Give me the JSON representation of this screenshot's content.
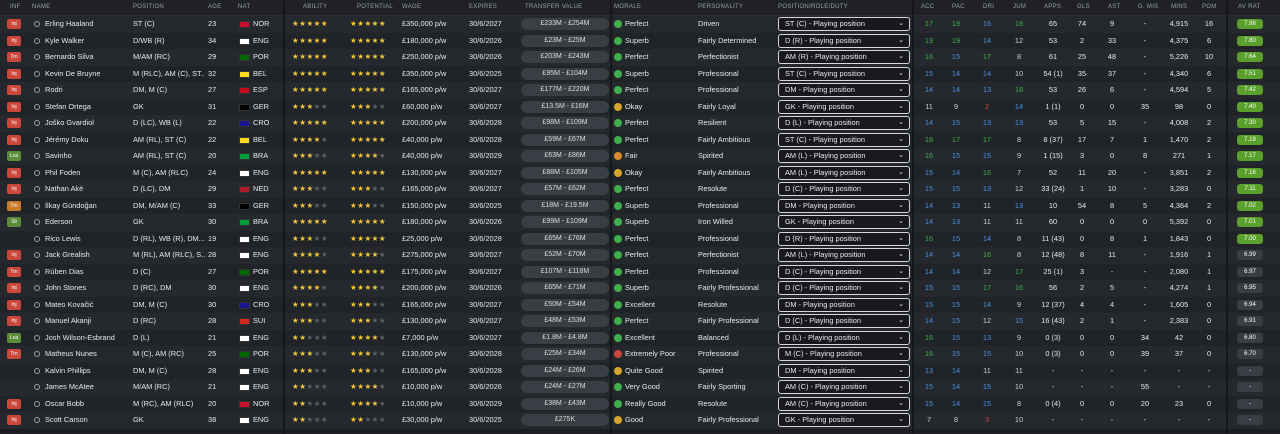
{
  "columns": {
    "inf": "INF",
    "name": "NAME",
    "position": "POSITION",
    "age": "AGE",
    "nat": "NAT",
    "ability": "ABILITY",
    "potential": "POTENTIAL",
    "wage": "WAGE",
    "expires": "EXPIRES",
    "transfer_value": "TRANSFER VALUE",
    "morale": "MORALE",
    "personality": "PERSONALITY",
    "role": "POSITION/ROLE/DUTY",
    "acc": "ACC",
    "pac": "PAC",
    "dri": "DRI",
    "jum": "JUM",
    "apps": "APPS",
    "gls": "GLS",
    "ast": "AST",
    "gmis": "G. MIS",
    "mins": "MINS",
    "pom": "POM",
    "avrat": "AV RAT"
  },
  "players": [
    {
      "inf": "Inj",
      "inf_color": "red",
      "name": "Erling Haaland",
      "position": "ST (C)",
      "age": "23",
      "nat": "NOR",
      "flag": "#c8102e",
      "ability": 5,
      "potential": 5,
      "wage": "£350,000 p/w",
      "expires": "30/6/2027",
      "tv": "£233M - £254M",
      "morale": "Perfect",
      "mico": "g",
      "personality": "Driven",
      "role": "ST (C) - Playing position",
      "acc": "17",
      "pac": "19",
      "dri": "15",
      "jum": "18",
      "apps": "65",
      "gls": "74",
      "ast": "9",
      "gmis": "-",
      "mins": "4,915",
      "pom": "16",
      "avrat": "7.98",
      "hi": true
    },
    {
      "inf": "Inj",
      "inf_color": "red",
      "name": "Kyle Walker",
      "position": "D/WB (R)",
      "age": "34",
      "nat": "ENG",
      "flag": "#ffffff",
      "ability": 4.5,
      "potential": 4.5,
      "wage": "£180,000 p/w",
      "expires": "30/6/2026",
      "tv": "£23M - £25M",
      "morale": "Superb",
      "mico": "g",
      "personality": "Fairly Determined",
      "role": "D (R) - Playing position",
      "acc": "19",
      "pac": "19",
      "dri": "14",
      "jum": "12",
      "apps": "53",
      "gls": "2",
      "ast": "33",
      "gmis": "-",
      "mins": "4,375",
      "pom": "6",
      "avrat": "7.80",
      "hi": true
    },
    {
      "inf": "Trn",
      "inf_color": "red",
      "name": "Bernardo Silva",
      "position": "M/AM (RC)",
      "age": "29",
      "nat": "POR",
      "flag": "#006600",
      "ability": 5,
      "potential": 5,
      "wage": "£250,000 p/w",
      "expires": "30/6/2026",
      "tv": "£203M - £243M",
      "morale": "Perfect",
      "mico": "g",
      "personality": "Perfectionist",
      "role": "AM (R) - Playing position",
      "acc": "16",
      "pac": "15",
      "dri": "17",
      "jum": "8",
      "apps": "61",
      "gls": "25",
      "ast": "48",
      "gmis": "-",
      "mins": "5,226",
      "pom": "10",
      "avrat": "7.64",
      "hi": true
    },
    {
      "inf": "Inj",
      "inf_color": "red",
      "name": "Kevin De Bruyne",
      "position": "M (RLC), AM (C), ST...",
      "age": "32",
      "nat": "BEL",
      "flag": "#fdda24",
      "ability": 5,
      "potential": 5,
      "wage": "£350,000 p/w",
      "expires": "30/6/2025",
      "tv": "£95M - £104M",
      "morale": "Superb",
      "mico": "g",
      "personality": "Professional",
      "role": "ST (C) - Playing position",
      "acc": "15",
      "pac": "14",
      "dri": "14",
      "jum": "10",
      "apps": "54 (1)",
      "gls": "35",
      "ast": "37",
      "gmis": "-",
      "mins": "4,340",
      "pom": "6",
      "avrat": "7.51",
      "hi": true
    },
    {
      "inf": "Inj",
      "inf_color": "red",
      "name": "Rodri",
      "position": "DM, M (C)",
      "age": "27",
      "nat": "ESP",
      "flag": "#c60b1e",
      "ability": 5,
      "potential": 5,
      "wage": "£165,000 p/w",
      "expires": "30/6/2027",
      "tv": "£177M - £220M",
      "morale": "Perfect",
      "mico": "g",
      "personality": "Professional",
      "role": "DM - Playing position",
      "acc": "14",
      "pac": "14",
      "dri": "13",
      "jum": "18",
      "apps": "53",
      "gls": "26",
      "ast": "6",
      "gmis": "-",
      "mins": "4,594",
      "pom": "5",
      "avrat": "7.42",
      "hi": true
    },
    {
      "inf": "Inj",
      "inf_color": "red",
      "name": "Stefan Ortega",
      "position": "GK",
      "age": "31",
      "nat": "GER",
      "flag": "#000000",
      "ability": 2.5,
      "potential": 2.5,
      "wage": "£60,000 p/w",
      "expires": "30/6/2027",
      "tv": "£13.5M - £16M",
      "morale": "Okay",
      "mico": "y",
      "personality": "Fairly Loyal",
      "role": "GK - Playing position",
      "acc": "11",
      "pac": "9",
      "dri": "2",
      "jum": "14",
      "apps": "1 (1)",
      "gls": "0",
      "ast": "0",
      "gmis": "35",
      "mins": "98",
      "pom": "0",
      "avrat": "7.40",
      "hi": true
    },
    {
      "inf": "Inj",
      "inf_color": "red",
      "name": "Joško Gvardiol",
      "position": "D (LC), WB (L)",
      "age": "22",
      "nat": "CRO",
      "flag": "#171796",
      "ability": 4.5,
      "potential": 5,
      "wage": "£200,000 p/w",
      "expires": "30/6/2028",
      "tv": "£98M - £109M",
      "morale": "Perfect",
      "mico": "g",
      "personality": "Resilient",
      "role": "D (L) - Playing position",
      "acc": "14",
      "pac": "15",
      "dri": "13",
      "jum": "13",
      "apps": "53",
      "gls": "5",
      "ast": "15",
      "gmis": "-",
      "mins": "4,008",
      "pom": "2",
      "avrat": "7.30",
      "hi": true
    },
    {
      "inf": "Inj",
      "inf_color": "red",
      "name": "Jérémy Doku",
      "position": "AM (RL), ST (C)",
      "age": "22",
      "nat": "BEL",
      "flag": "#fdda24",
      "ability": 4,
      "potential": 4.5,
      "wage": "£40,000 p/w",
      "expires": "30/6/2028",
      "tv": "£59M - £67M",
      "morale": "Perfect",
      "mico": "g",
      "personality": "Fairly Ambitious",
      "role": "ST (C) - Playing position",
      "acc": "18",
      "pac": "17",
      "dri": "17",
      "jum": "8",
      "apps": "8 (37)",
      "gls": "17",
      "ast": "7",
      "gmis": "1",
      "mins": "1,470",
      "pom": "2",
      "avrat": "7.19",
      "hi": true
    },
    {
      "inf": "Loa",
      "inf_color": "green",
      "name": "Savinho",
      "position": "AM (RL), ST (C)",
      "age": "20",
      "nat": "BRA",
      "flag": "#009c3b",
      "ability": 2.5,
      "potential": 4,
      "wage": "£40,000 p/w",
      "expires": "30/6/2029",
      "tv": "£63M - £86M",
      "morale": "Fair",
      "mico": "o",
      "personality": "Spirited",
      "role": "AM (L) - Playing position",
      "acc": "16",
      "pac": "15",
      "dri": "15",
      "jum": "9",
      "apps": "1 (15)",
      "gls": "3",
      "ast": "0",
      "gmis": "8",
      "mins": "271",
      "pom": "1",
      "avrat": "7.17",
      "hi": true
    },
    {
      "inf": "Inj",
      "inf_color": "red",
      "name": "Phil Foden",
      "position": "M (C), AM (RLC)",
      "age": "24",
      "nat": "ENG",
      "flag": "#ffffff",
      "ability": 4.5,
      "potential": 4.5,
      "wage": "£130,000 p/w",
      "expires": "30/6/2027",
      "tv": "£88M - £105M",
      "morale": "Okay",
      "mico": "y",
      "personality": "Fairly Ambitious",
      "role": "AM (L) - Playing position",
      "acc": "15",
      "pac": "14",
      "dri": "16",
      "jum": "7",
      "apps": "52",
      "gls": "11",
      "ast": "20",
      "gmis": "-",
      "mins": "3,851",
      "pom": "2",
      "avrat": "7.16",
      "hi": true
    },
    {
      "inf": "Inj",
      "inf_color": "red",
      "name": "Nathan Aké",
      "position": "D (LC), DM",
      "age": "29",
      "nat": "NED",
      "flag": "#ae1c28",
      "ability": 3,
      "potential": 3,
      "wage": "£165,000 p/w",
      "expires": "30/6/2027",
      "tv": "£57M - £62M",
      "morale": "Perfect",
      "mico": "g",
      "personality": "Resolute",
      "role": "D (C) - Playing position",
      "acc": "15",
      "pac": "15",
      "dri": "13",
      "jum": "12",
      "apps": "33 (24)",
      "gls": "1",
      "ast": "10",
      "gmis": "-",
      "mins": "3,283",
      "pom": "0",
      "avrat": "7.11",
      "hi": true
    },
    {
      "inf": "Trn",
      "inf_color": "orange",
      "name": "İlkay Gündoğan",
      "position": "DM, M/AM (C)",
      "age": "33",
      "nat": "GER",
      "flag": "#000000",
      "ability": 3,
      "potential": 3,
      "wage": "£150,000 p/w",
      "expires": "30/6/2025",
      "tv": "£18M - £19.5M",
      "morale": "Superb",
      "mico": "g",
      "personality": "Professional",
      "role": "DM - Playing position",
      "acc": "14",
      "pac": "13",
      "dri": "11",
      "jum": "13",
      "apps": "10",
      "gls": "54",
      "ast": "8",
      "gmis": "5",
      "mins": "4,364",
      "pom": "2",
      "avrat": "7.02",
      "hi": true
    },
    {
      "inf": "Sli",
      "inf_color": "green",
      "name": "Ederson",
      "position": "GK",
      "age": "30",
      "nat": "BRA",
      "flag": "#009c3b",
      "ability": 4.5,
      "potential": 4.5,
      "wage": "£180,000 p/w",
      "expires": "30/6/2026",
      "tv": "£99M - £109M",
      "morale": "Superb",
      "mico": "g",
      "personality": "Iron Willed",
      "role": "GK - Playing position",
      "acc": "14",
      "pac": "13",
      "dri": "11",
      "jum": "11",
      "apps": "60",
      "gls": "0",
      "ast": "0",
      "gmis": "0",
      "mins": "5,392",
      "pom": "0",
      "avrat": "7.01",
      "hi": true
    },
    {
      "inf": "",
      "inf_color": "none",
      "name": "Rico Lewis",
      "position": "D (RL), WB (R), DM...",
      "age": "19",
      "nat": "ENG",
      "flag": "#ffffff",
      "ability": 3,
      "potential": 4.5,
      "wage": "£25,000 p/w",
      "expires": "30/6/2028",
      "tv": "£65M - £76M",
      "morale": "Perfect",
      "mico": "g",
      "personality": "Professional",
      "role": "D (R) - Playing position",
      "acc": "16",
      "pac": "15",
      "dri": "14",
      "jum": "8",
      "apps": "11 (43)",
      "gls": "0",
      "ast": "8",
      "gmis": "1",
      "mins": "1,843",
      "pom": "0",
      "avrat": "7.00",
      "hi": true
    },
    {
      "inf": "Inj",
      "inf_color": "red",
      "name": "Jack Grealish",
      "position": "M (RL), AM (RLC), S...",
      "age": "28",
      "nat": "ENG",
      "flag": "#ffffff",
      "ability": 3.5,
      "potential": 3.5,
      "wage": "£275,000 p/w",
      "expires": "30/6/2027",
      "tv": "£52M - £70M",
      "morale": "Perfect",
      "mico": "g",
      "personality": "Perfectionist",
      "role": "AM (L) - Playing position",
      "acc": "14",
      "pac": "14",
      "dri": "16",
      "jum": "8",
      "apps": "12 (48)",
      "gls": "8",
      "ast": "11",
      "gmis": "-",
      "mins": "1,916",
      "pom": "1",
      "avrat": "6.99",
      "hi": false
    },
    {
      "inf": "Trn",
      "inf_color": "red",
      "name": "Rúben Dias",
      "position": "D (C)",
      "age": "27",
      "nat": "POR",
      "flag": "#006600",
      "ability": 4.5,
      "potential": 4.5,
      "wage": "£175,000 p/w",
      "expires": "30/6/2027",
      "tv": "£107M - £118M",
      "morale": "Perfect",
      "mico": "g",
      "personality": "Professional",
      "role": "D (C) - Playing position",
      "acc": "14",
      "pac": "14",
      "dri": "12",
      "jum": "17",
      "apps": "25 (1)",
      "gls": "3",
      "ast": "-",
      "gmis": "-",
      "mins": "2,080",
      "pom": "1",
      "avrat": "6.97",
      "hi": false
    },
    {
      "inf": "Inj",
      "inf_color": "red",
      "name": "John Stones",
      "position": "D (RC), DM",
      "age": "30",
      "nat": "ENG",
      "flag": "#ffffff",
      "ability": 3.5,
      "potential": 3.5,
      "wage": "£200,000 p/w",
      "expires": "30/6/2026",
      "tv": "£65M - £71M",
      "morale": "Superb",
      "mico": "g",
      "personality": "Fairly Professional",
      "role": "D (C) - Playing position",
      "acc": "15",
      "pac": "15",
      "dri": "17",
      "jum": "16",
      "apps": "56",
      "gls": "2",
      "ast": "5",
      "gmis": "-",
      "mins": "4,274",
      "pom": "1",
      "avrat": "6.95",
      "hi": false
    },
    {
      "inf": "Inj",
      "inf_color": "red",
      "name": "Mateo Kovačić",
      "position": "DM, M (C)",
      "age": "30",
      "nat": "CRO",
      "flag": "#171796",
      "ability": 3,
      "potential": 3,
      "wage": "£165,000 p/w",
      "expires": "30/6/2027",
      "tv": "£50M - £54M",
      "morale": "Excellent",
      "mico": "g",
      "personality": "Resolute",
      "role": "DM - Playing position",
      "acc": "15",
      "pac": "15",
      "dri": "14",
      "jum": "9",
      "apps": "12 (37)",
      "gls": "4",
      "ast": "4",
      "gmis": "-",
      "mins": "1,605",
      "pom": "0",
      "avrat": "6.94",
      "hi": false
    },
    {
      "inf": "Inj",
      "inf_color": "red",
      "name": "Manuel Akanji",
      "position": "D (RC)",
      "age": "28",
      "nat": "SUI",
      "flag": "#d52b1e",
      "ability": 3,
      "potential": 3,
      "wage": "£130,000 p/w",
      "expires": "30/6/2027",
      "tv": "£48M - £53M",
      "morale": "Perfect",
      "mico": "g",
      "personality": "Fairly Professional",
      "role": "D (C) - Playing position",
      "acc": "14",
      "pac": "15",
      "dri": "12",
      "jum": "15",
      "apps": "16 (43)",
      "gls": "2",
      "ast": "1",
      "gmis": "-",
      "mins": "2,383",
      "pom": "0",
      "avrat": "6.91",
      "hi": false
    },
    {
      "inf": "Loa",
      "inf_color": "green",
      "name": "Josh Wilson-Esbrand",
      "position": "D (L)",
      "age": "21",
      "nat": "ENG",
      "flag": "#ffffff",
      "ability": 2,
      "potential": 3.5,
      "wage": "£7,000 p/w",
      "expires": "30/6/2027",
      "tv": "£1.8M - £4.8M",
      "morale": "Excellent",
      "mico": "g",
      "personality": "Balanced",
      "role": "D (L) - Playing position",
      "acc": "16",
      "pac": "15",
      "dri": "13",
      "jum": "9",
      "apps": "0 (3)",
      "gls": "0",
      "ast": "0",
      "gmis": "34",
      "mins": "42",
      "pom": "0",
      "avrat": "6.80",
      "hi": false
    },
    {
      "inf": "Trn",
      "inf_color": "red",
      "name": "Matheus Nunes",
      "position": "M (C), AM (RC)",
      "age": "25",
      "nat": "POR",
      "flag": "#006600",
      "ability": 3,
      "potential": 3,
      "wage": "£130,000 p/w",
      "expires": "30/6/2028",
      "tv": "£25M - £34M",
      "morale": "Extremely Poor",
      "mico": "r",
      "personality": "Professional",
      "role": "M (C) - Playing position",
      "acc": "16",
      "pac": "15",
      "dri": "15",
      "jum": "10",
      "apps": "0 (3)",
      "gls": "0",
      "ast": "0",
      "gmis": "39",
      "mins": "37",
      "pom": "0",
      "avrat": "6.70",
      "hi": false
    },
    {
      "inf": "",
      "inf_color": "none",
      "name": "Kalvin Phillips",
      "position": "DM, M (C)",
      "age": "28",
      "nat": "ENG",
      "flag": "#ffffff",
      "ability": 3,
      "potential": 3,
      "wage": "£165,000 p/w",
      "expires": "30/6/2028",
      "tv": "£24M - £26M",
      "morale": "Quite Good",
      "mico": "y",
      "personality": "Spirited",
      "role": "DM - Playing position",
      "acc": "13",
      "pac": "14",
      "dri": "11",
      "jum": "11",
      "apps": "-",
      "gls": "-",
      "ast": "-",
      "gmis": "-",
      "mins": "-",
      "pom": "-",
      "avrat": "-",
      "hi": false
    },
    {
      "inf": "",
      "inf_color": "none",
      "name": "James McAtee",
      "position": "M/AM (RC)",
      "age": "21",
      "nat": "ENG",
      "flag": "#ffffff",
      "ability": 2,
      "potential": 3.5,
      "wage": "£10,000 p/w",
      "expires": "30/6/2026",
      "tv": "£24M - £27M",
      "morale": "Very Good",
      "mico": "g",
      "personality": "Fairly Sporting",
      "role": "AM (C) - Playing position",
      "acc": "15",
      "pac": "14",
      "dri": "15",
      "jum": "10",
      "apps": "-",
      "gls": "-",
      "ast": "-",
      "gmis": "55",
      "mins": "-",
      "pom": "-",
      "avrat": "-",
      "hi": false
    },
    {
      "inf": "Inj",
      "inf_color": "red",
      "name": "Oscar Bobb",
      "position": "M (RC), AM (RLC)",
      "age": "20",
      "nat": "NOR",
      "flag": "#c8102e",
      "ability": 2,
      "potential": 3.5,
      "wage": "£10,000 p/w",
      "expires": "30/6/2029",
      "tv": "£38M - £43M",
      "morale": "Really Good",
      "mico": "g",
      "personality": "Resolute",
      "role": "AM (C) - Playing position",
      "acc": "15",
      "pac": "14",
      "dri": "15",
      "jum": "8",
      "apps": "0 (4)",
      "gls": "0",
      "ast": "0",
      "gmis": "20",
      "mins": "23",
      "pom": "0",
      "avrat": "-",
      "hi": false
    },
    {
      "inf": "Inj",
      "inf_color": "red",
      "name": "Scott Carson",
      "position": "GK",
      "age": "38",
      "nat": "ENG",
      "flag": "#ffffff",
      "ability": 1.5,
      "potential": 1.5,
      "wage": "£30,000 p/w",
      "expires": "30/6/2025",
      "tv": "£275K",
      "morale": "Good",
      "mico": "y",
      "personality": "Fairly Professional",
      "role": "GK - Playing position",
      "acc": "7",
      "pac": "8",
      "dri": "3",
      "jum": "10",
      "apps": "-",
      "gls": "-",
      "ast": "-",
      "gmis": "-",
      "mins": "-",
      "pom": "-",
      "avrat": "-",
      "hi": false
    }
  ],
  "colors": {
    "star": "#f0c63a",
    "green": "#3fae4c",
    "blue": "#4a90e2",
    "red": "#c9483b"
  }
}
